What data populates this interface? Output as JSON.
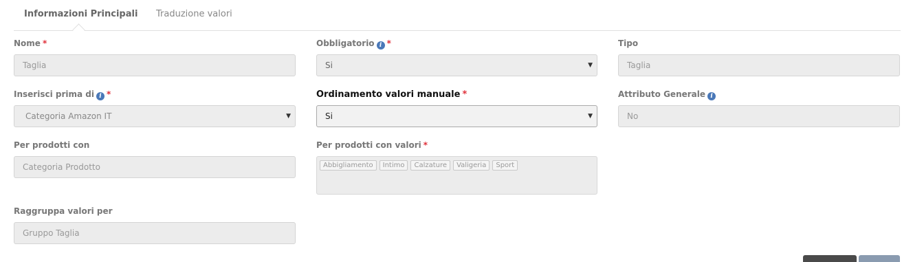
{
  "tabs": [
    {
      "label": "Informazioni Principali",
      "active": true
    },
    {
      "label": "Traduzione valori",
      "active": false
    }
  ],
  "fields": {
    "nome": {
      "label": "Nome",
      "value": "Taglia"
    },
    "obbligatorio": {
      "label": "Obbligatorio",
      "value": "Si"
    },
    "tipo": {
      "label": "Tipo",
      "value": "Taglia"
    },
    "inserisci_prima": {
      "label": "Inserisci prima di",
      "value": "Categoria Amazon IT"
    },
    "ordinamento": {
      "label": "Ordinamento valori manuale",
      "value": "Si"
    },
    "attributo_generale": {
      "label": "Attributo Generale",
      "value": "No"
    },
    "per_prodotti_con": {
      "label": "Per prodotti con",
      "value": "Categoria Prodotto"
    },
    "per_prodotti_valori": {
      "label": "Per prodotti con valori",
      "tags": [
        "Abbigliamento",
        "Intimo",
        "Calzature",
        "Valigeria",
        "Sport"
      ]
    },
    "raggruppa": {
      "label": "Raggruppa valori per",
      "value": "Gruppo Taglia"
    }
  },
  "required_mark": "*",
  "info_icon": "i",
  "colors": {
    "required": "#e0303a",
    "info": "#4a78b8",
    "button_primary": "#4a4a4a",
    "button_secondary": "#8a9bb0"
  }
}
